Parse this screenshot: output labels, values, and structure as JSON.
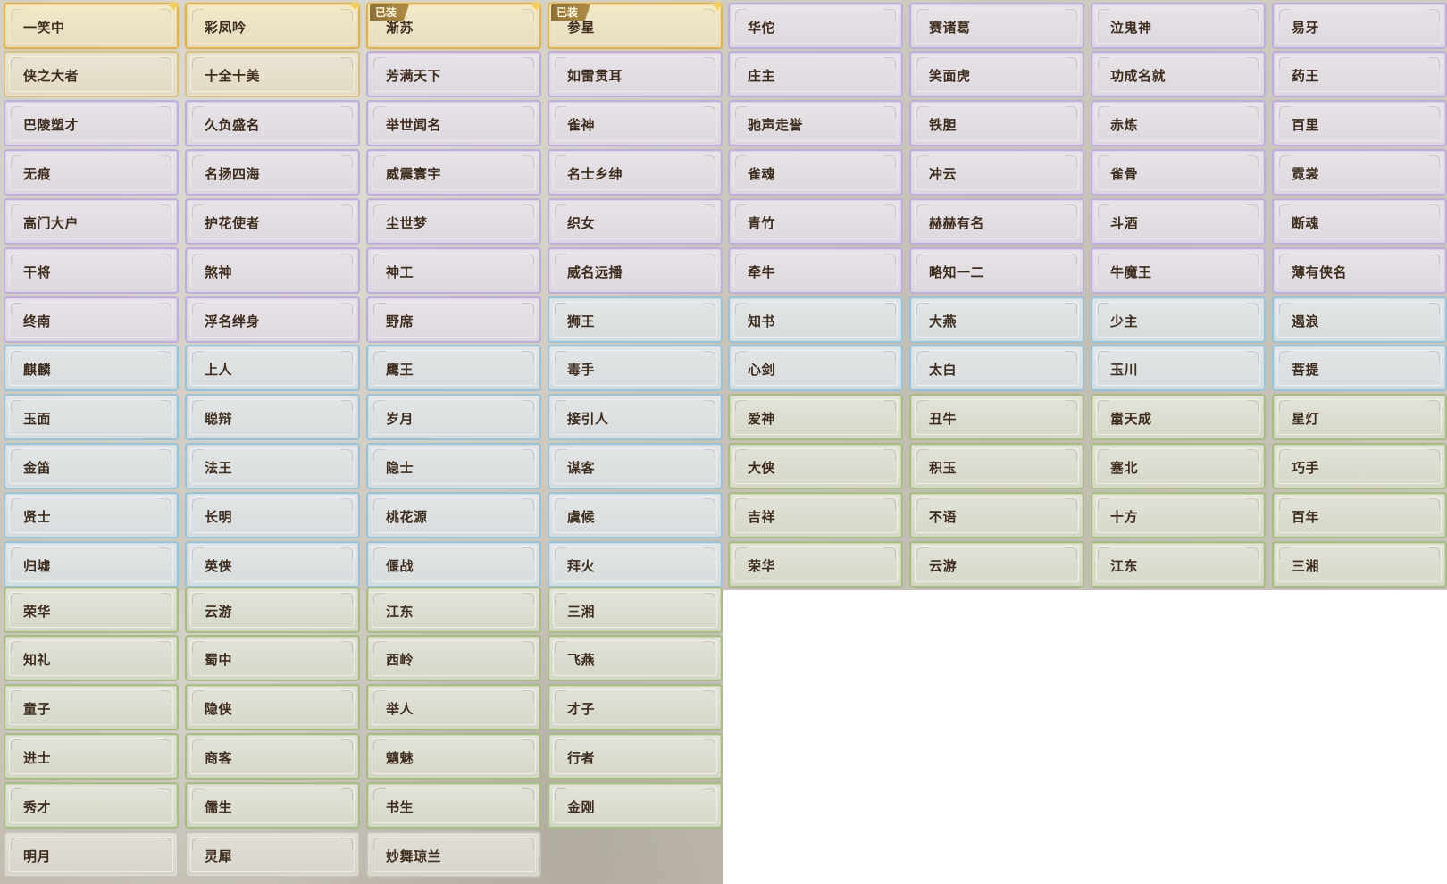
{
  "colors": {
    "gold": "#d9b25b",
    "cream": "#d6c08b",
    "purple": "#bfaed6",
    "blue": "#9cc2d6",
    "green": "#a8bb88",
    "gray": "#c6c1b6",
    "label_text": "#3e2d1e"
  },
  "badge_text": "已装",
  "icons": {
    "corner_star": "sparkle-star-icon"
  },
  "titles": [
    {
      "label": "一笑中",
      "rarity": "gold",
      "starred": true,
      "equipped": false
    },
    {
      "label": "彩凤吟",
      "rarity": "gold",
      "starred": true,
      "equipped": false
    },
    {
      "label": "渐苏",
      "rarity": "gold",
      "starred": true,
      "equipped": true
    },
    {
      "label": "参星",
      "rarity": "gold",
      "starred": true,
      "equipped": true
    },
    {
      "label": "华佗",
      "rarity": "purple",
      "starred": false,
      "equipped": false
    },
    {
      "label": "赛诸葛",
      "rarity": "purple",
      "starred": false,
      "equipped": false
    },
    {
      "label": "泣鬼神",
      "rarity": "purple",
      "starred": false,
      "equipped": false
    },
    {
      "label": "易牙",
      "rarity": "purple",
      "starred": false,
      "equipped": false
    },
    {
      "label": "侠之大者",
      "rarity": "cream",
      "starred": false,
      "equipped": false
    },
    {
      "label": "十全十美",
      "rarity": "cream",
      "starred": false,
      "equipped": false
    },
    {
      "label": "芳满天下",
      "rarity": "purple",
      "starred": false,
      "equipped": false
    },
    {
      "label": "如雷贯耳",
      "rarity": "purple",
      "starred": false,
      "equipped": false
    },
    {
      "label": "庄主",
      "rarity": "purple",
      "starred": false,
      "equipped": false
    },
    {
      "label": "笑面虎",
      "rarity": "purple",
      "starred": false,
      "equipped": false
    },
    {
      "label": "功成名就",
      "rarity": "purple",
      "starred": false,
      "equipped": false
    },
    {
      "label": "药王",
      "rarity": "purple",
      "starred": false,
      "equipped": false
    },
    {
      "label": "巴陵塑才",
      "rarity": "purple",
      "starred": false,
      "equipped": false
    },
    {
      "label": "久负盛名",
      "rarity": "purple",
      "starred": false,
      "equipped": false
    },
    {
      "label": "举世闻名",
      "rarity": "purple",
      "starred": false,
      "equipped": false
    },
    {
      "label": "雀神",
      "rarity": "purple",
      "starred": false,
      "equipped": false
    },
    {
      "label": "驰声走誉",
      "rarity": "purple",
      "starred": false,
      "equipped": false
    },
    {
      "label": "铁胆",
      "rarity": "purple",
      "starred": false,
      "equipped": false
    },
    {
      "label": "赤炼",
      "rarity": "purple",
      "starred": false,
      "equipped": false
    },
    {
      "label": "百里",
      "rarity": "purple",
      "starred": false,
      "equipped": false
    },
    {
      "label": "无痕",
      "rarity": "purple",
      "starred": false,
      "equipped": false
    },
    {
      "label": "名扬四海",
      "rarity": "purple",
      "starred": false,
      "equipped": false
    },
    {
      "label": "威震寰宇",
      "rarity": "purple",
      "starred": false,
      "equipped": false
    },
    {
      "label": "名士乡绅",
      "rarity": "purple",
      "starred": false,
      "equipped": false
    },
    {
      "label": "雀魂",
      "rarity": "purple",
      "starred": false,
      "equipped": false
    },
    {
      "label": "冲云",
      "rarity": "purple",
      "starred": false,
      "equipped": false
    },
    {
      "label": "雀骨",
      "rarity": "purple",
      "starred": false,
      "equipped": false
    },
    {
      "label": "霓裳",
      "rarity": "purple",
      "starred": false,
      "equipped": false
    },
    {
      "label": "高门大户",
      "rarity": "purple",
      "starred": false,
      "equipped": false
    },
    {
      "label": "护花使者",
      "rarity": "purple",
      "starred": false,
      "equipped": false
    },
    {
      "label": "尘世梦",
      "rarity": "purple",
      "starred": false,
      "equipped": false
    },
    {
      "label": "织女",
      "rarity": "purple",
      "starred": false,
      "equipped": false
    },
    {
      "label": "青竹",
      "rarity": "purple",
      "starred": false,
      "equipped": false
    },
    {
      "label": "赫赫有名",
      "rarity": "purple",
      "starred": false,
      "equipped": false
    },
    {
      "label": "斗酒",
      "rarity": "purple",
      "starred": false,
      "equipped": false
    },
    {
      "label": "断魂",
      "rarity": "purple",
      "starred": false,
      "equipped": false
    },
    {
      "label": "干将",
      "rarity": "purple",
      "starred": false,
      "equipped": false
    },
    {
      "label": "煞神",
      "rarity": "purple",
      "starred": false,
      "equipped": false
    },
    {
      "label": "神工",
      "rarity": "purple",
      "starred": false,
      "equipped": false
    },
    {
      "label": "威名远播",
      "rarity": "purple",
      "starred": false,
      "equipped": false
    },
    {
      "label": "牵牛",
      "rarity": "purple",
      "starred": false,
      "equipped": false
    },
    {
      "label": "略知一二",
      "rarity": "purple",
      "starred": false,
      "equipped": false
    },
    {
      "label": "牛魔王",
      "rarity": "purple",
      "starred": false,
      "equipped": false
    },
    {
      "label": "薄有侠名",
      "rarity": "purple",
      "starred": false,
      "equipped": false
    },
    {
      "label": "终南",
      "rarity": "purple",
      "starred": false,
      "equipped": false
    },
    {
      "label": "浮名绊身",
      "rarity": "purple",
      "starred": false,
      "equipped": false
    },
    {
      "label": "野席",
      "rarity": "purple",
      "starred": false,
      "equipped": false
    },
    {
      "label": "狮王",
      "rarity": "blue",
      "starred": false,
      "equipped": false
    },
    {
      "label": "知书",
      "rarity": "blue",
      "starred": false,
      "equipped": false
    },
    {
      "label": "大燕",
      "rarity": "blue",
      "starred": false,
      "equipped": false
    },
    {
      "label": "少主",
      "rarity": "blue",
      "starred": false,
      "equipped": false
    },
    {
      "label": "遏浪",
      "rarity": "blue",
      "starred": false,
      "equipped": false
    },
    {
      "label": "麒麟",
      "rarity": "blue",
      "starred": false,
      "equipped": false
    },
    {
      "label": "上人",
      "rarity": "blue",
      "starred": false,
      "equipped": false
    },
    {
      "label": "鹰王",
      "rarity": "blue",
      "starred": false,
      "equipped": false
    },
    {
      "label": "毒手",
      "rarity": "blue",
      "starred": false,
      "equipped": false
    },
    {
      "label": "心剑",
      "rarity": "blue",
      "starred": false,
      "equipped": false
    },
    {
      "label": "太白",
      "rarity": "blue",
      "starred": false,
      "equipped": false
    },
    {
      "label": "玉川",
      "rarity": "blue",
      "starred": false,
      "equipped": false
    },
    {
      "label": "菩提",
      "rarity": "blue",
      "starred": false,
      "equipped": false
    },
    {
      "label": "玉面",
      "rarity": "blue",
      "starred": false,
      "equipped": false
    },
    {
      "label": "聪辩",
      "rarity": "blue",
      "starred": false,
      "equipped": false
    },
    {
      "label": "岁月",
      "rarity": "blue",
      "starred": false,
      "equipped": false
    },
    {
      "label": "接引人",
      "rarity": "blue",
      "starred": false,
      "equipped": false
    },
    {
      "label": "爱神",
      "rarity": "green",
      "starred": false,
      "equipped": false
    },
    {
      "label": "丑牛",
      "rarity": "green",
      "starred": false,
      "equipped": false
    },
    {
      "label": "嚣天成",
      "rarity": "green",
      "starred": false,
      "equipped": false
    },
    {
      "label": "星灯",
      "rarity": "green",
      "starred": false,
      "equipped": false
    },
    {
      "label": "金笛",
      "rarity": "blue",
      "starred": false,
      "equipped": false
    },
    {
      "label": "法王",
      "rarity": "blue",
      "starred": false,
      "equipped": false
    },
    {
      "label": "隐士",
      "rarity": "blue",
      "starred": false,
      "equipped": false
    },
    {
      "label": "谋客",
      "rarity": "blue",
      "starred": false,
      "equipped": false
    },
    {
      "label": "大侠",
      "rarity": "green",
      "starred": false,
      "equipped": false
    },
    {
      "label": "积玉",
      "rarity": "green",
      "starred": false,
      "equipped": false
    },
    {
      "label": "塞北",
      "rarity": "green",
      "starred": false,
      "equipped": false
    },
    {
      "label": "巧手",
      "rarity": "green",
      "starred": false,
      "equipped": false
    },
    {
      "label": "贤士",
      "rarity": "blue",
      "starred": false,
      "equipped": false
    },
    {
      "label": "长明",
      "rarity": "blue",
      "starred": false,
      "equipped": false
    },
    {
      "label": "桃花源",
      "rarity": "blue",
      "starred": false,
      "equipped": false
    },
    {
      "label": "虞候",
      "rarity": "blue",
      "starred": false,
      "equipped": false
    },
    {
      "label": "吉祥",
      "rarity": "green",
      "starred": false,
      "equipped": false
    },
    {
      "label": "不语",
      "rarity": "green",
      "starred": false,
      "equipped": false
    },
    {
      "label": "十方",
      "rarity": "green",
      "starred": false,
      "equipped": false
    },
    {
      "label": "百年",
      "rarity": "green",
      "starred": false,
      "equipped": false
    },
    {
      "label": "归墟",
      "rarity": "blue",
      "starred": false,
      "equipped": false
    },
    {
      "label": "英侠",
      "rarity": "blue",
      "starred": false,
      "equipped": false
    },
    {
      "label": "偃战",
      "rarity": "blue",
      "starred": false,
      "equipped": false
    },
    {
      "label": "拜火",
      "rarity": "blue",
      "starred": false,
      "equipped": false
    },
    {
      "label": "荣华",
      "rarity": "green",
      "starred": false,
      "equipped": false
    },
    {
      "label": "云游",
      "rarity": "green",
      "starred": false,
      "equipped": false
    },
    {
      "label": "江东",
      "rarity": "green",
      "starred": false,
      "equipped": false
    },
    {
      "label": "三湘",
      "rarity": "green",
      "starred": false,
      "equipped": false
    },
    {
      "label": "荣华",
      "rarity": "green",
      "starred": false,
      "equipped": false
    },
    {
      "label": "云游",
      "rarity": "green",
      "starred": false,
      "equipped": false
    },
    {
      "label": "江东",
      "rarity": "green",
      "starred": false,
      "equipped": false
    },
    {
      "label": "三湘",
      "rarity": "green",
      "starred": false,
      "equipped": false
    },
    {
      "label": "知礼",
      "rarity": "green",
      "starred": false,
      "equipped": false
    },
    {
      "label": "蜀中",
      "rarity": "green",
      "starred": false,
      "equipped": false
    },
    {
      "label": "西岭",
      "rarity": "green",
      "starred": false,
      "equipped": false
    },
    {
      "label": "飞燕",
      "rarity": "green",
      "starred": false,
      "equipped": false
    },
    {
      "label": "童子",
      "rarity": "green",
      "starred": false,
      "equipped": false
    },
    {
      "label": "隐侠",
      "rarity": "green",
      "starred": false,
      "equipped": false
    },
    {
      "label": "举人",
      "rarity": "green",
      "starred": false,
      "equipped": false
    },
    {
      "label": "才子",
      "rarity": "green",
      "starred": false,
      "equipped": false
    },
    {
      "label": "进士",
      "rarity": "green",
      "starred": false,
      "equipped": false
    },
    {
      "label": "商客",
      "rarity": "green",
      "starred": false,
      "equipped": false
    },
    {
      "label": "魑魅",
      "rarity": "green",
      "starred": false,
      "equipped": false
    },
    {
      "label": "行者",
      "rarity": "green",
      "starred": false,
      "equipped": false
    },
    {
      "label": "秀才",
      "rarity": "green",
      "starred": false,
      "equipped": false
    },
    {
      "label": "儒生",
      "rarity": "green",
      "starred": false,
      "equipped": false
    },
    {
      "label": "书生",
      "rarity": "green",
      "starred": false,
      "equipped": false
    },
    {
      "label": "金刚",
      "rarity": "green",
      "starred": false,
      "equipped": false
    },
    {
      "label": "明月",
      "rarity": "gray",
      "starred": false,
      "equipped": false
    },
    {
      "label": "灵犀",
      "rarity": "gray",
      "starred": false,
      "equipped": false
    },
    {
      "label": "妙舞琼兰",
      "rarity": "gray",
      "starred": false,
      "equipped": false
    }
  ]
}
